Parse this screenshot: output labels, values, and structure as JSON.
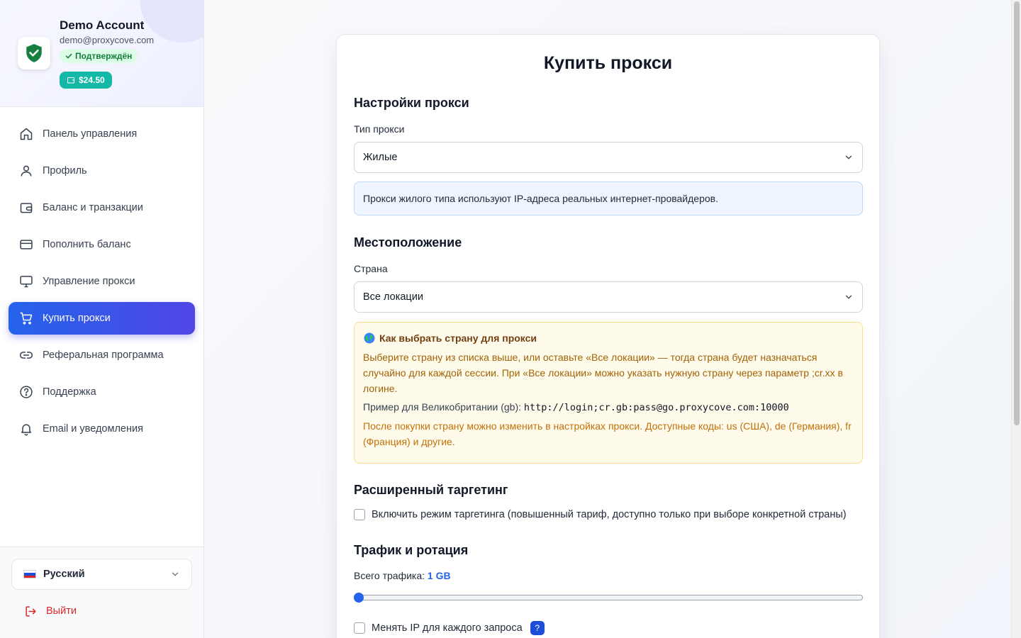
{
  "colors": {
    "accent": "#4f46e5",
    "primary_blue": "#2563eb",
    "success": "#15803d",
    "balance_badge": "#14b8a6",
    "danger": "#dc2626"
  },
  "account": {
    "name": "Demo Account",
    "email": "demo@proxycove.com",
    "verified_label": "Подтверждён",
    "balance": "$24.50"
  },
  "sidebar": {
    "items": [
      {
        "label": "Панель управления",
        "icon": "home-icon"
      },
      {
        "label": "Профиль",
        "icon": "user-icon"
      },
      {
        "label": "Баланс и транзакции",
        "icon": "wallet-icon"
      },
      {
        "label": "Пополнить баланс",
        "icon": "credit-card-icon"
      },
      {
        "label": "Управление прокси",
        "icon": "monitor-icon"
      },
      {
        "label": "Купить прокси",
        "icon": "cart-icon",
        "active": true
      },
      {
        "label": "Реферальная программа",
        "icon": "link-icon"
      },
      {
        "label": "Поддержка",
        "icon": "help-circle-icon"
      },
      {
        "label": "Email и уведомления",
        "icon": "bell-icon"
      }
    ],
    "language": "Русский",
    "logout": "Выйти"
  },
  "page": {
    "title": "Купить прокси",
    "proxy_settings": {
      "heading": "Настройки прокси",
      "type_label": "Тип прокси",
      "type_value": "Жилые",
      "type_info": "Прокси жилого типа используют IP-адреса реальных интернет-провайдеров."
    },
    "location": {
      "heading": "Местоположение",
      "country_label": "Страна",
      "country_value": "Все локации",
      "help_title": "Как выбрать страну для прокси",
      "help_text": "Выберите страну из списка выше, или оставьте «Все локации» — тогда страна будет назначаться случайно для каждой сессии. При «Все локации» можно указать нужную страну через параметр ;cr.xx в логине.",
      "example_label": "Пример для Великобритании (gb):",
      "example_code": "http://login;cr.gb:pass@go.proxycove.com:10000",
      "after_text": "После покупки страну можно изменить в настройках прокси. Доступные коды: us (США), de (Германия), fr (Франция) и другие."
    },
    "targeting": {
      "heading": "Расширенный таргетинг",
      "checkbox_label": "Включить режим таргетинга (повышенный тариф, доступно только при выборе конкретной страны)"
    },
    "traffic": {
      "heading": "Трафик и ротация",
      "total_label": "Всего трафика:",
      "total_value": "1 GB",
      "slider_fraction": 0.0,
      "rotate_label": "Менять IP для каждого запроса",
      "help_badge": "?"
    }
  }
}
